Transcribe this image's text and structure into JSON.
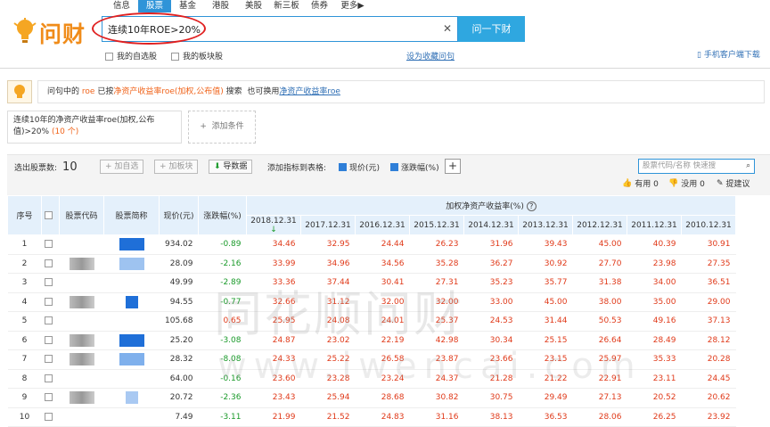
{
  "nav": {
    "tabs": [
      "信息",
      "股票",
      "基金",
      "港股",
      "美股",
      "新三板",
      "债券",
      "更多▶"
    ],
    "active": 1
  },
  "logo": {
    "text": "问财"
  },
  "search": {
    "value": "连续10年ROE>20%",
    "button": "问一下财"
  },
  "options": {
    "my_stocks": "我的自选股",
    "my_sectors": "我的板块股",
    "save_question": "设为收藏问句",
    "mobile": "手机客户端下载"
  },
  "notice": {
    "p1": "问句中的",
    "roe": "roe",
    "p2": "已按",
    "roe_full": "净资产收益率roe(加权,公布值)",
    "p3": "搜索",
    "p4": "也可换用",
    "alt": "净资产收益率roe"
  },
  "condition": {
    "text": "连续10年的净资产收益率roe(加权,公布值)>20%",
    "count": "(10 个)",
    "add": "添加条件"
  },
  "toolbar": {
    "count_label": "选出股票数:",
    "count": "10",
    "add_fav": "加自选",
    "add_sector": "加板块",
    "export": "导数据",
    "indicator_label": "添加指标到表格:",
    "ind_price": "现价(元)",
    "ind_change": "涨跌幅(%)",
    "plus": "+",
    "search_placeholder": "股票代码/名称 快速搜",
    "useful": "有用 0",
    "useless": "没用 0",
    "suggest": "提建议"
  },
  "table": {
    "headers": {
      "seq": "序号",
      "code": "股票代码",
      "name": "股票简称",
      "price": "现价(元)",
      "change": "涨跌幅(%)",
      "roe_group": "加权净资产收益率(%)"
    },
    "years": [
      "2018.12.31",
      "2017.12.31",
      "2016.12.31",
      "2015.12.31",
      "2014.12.31",
      "2013.12.31",
      "2012.12.31",
      "2011.12.31",
      "2010.12.31"
    ],
    "rows": [
      {
        "seq": "1",
        "price": "934.02",
        "change": "-0.89",
        "roe": [
          "34.46",
          "32.95",
          "24.44",
          "26.23",
          "31.96",
          "39.43",
          "45.00",
          "40.39",
          "30.91"
        ]
      },
      {
        "seq": "2",
        "price": "28.09",
        "change": "-2.16",
        "roe": [
          "33.99",
          "34.96",
          "34.56",
          "35.28",
          "36.27",
          "30.92",
          "27.70",
          "23.98",
          "27.35"
        ]
      },
      {
        "seq": "3",
        "price": "49.99",
        "change": "-2.89",
        "roe": [
          "33.36",
          "37.44",
          "30.41",
          "27.31",
          "35.23",
          "35.77",
          "31.38",
          "34.00",
          "36.51"
        ]
      },
      {
        "seq": "4",
        "price": "94.55",
        "change": "-0.77",
        "roe": [
          "32.66",
          "31.12",
          "32.00",
          "32.00",
          "33.00",
          "45.00",
          "38.00",
          "35.00",
          "29.00"
        ]
      },
      {
        "seq": "5",
        "price": "105.68",
        "change": "0.65",
        "roe": [
          "25.95",
          "24.08",
          "24.01",
          "25.37",
          "24.53",
          "31.44",
          "50.53",
          "49.16",
          "37.13"
        ]
      },
      {
        "seq": "6",
        "price": "25.20",
        "change": "-3.08",
        "roe": [
          "24.87",
          "23.02",
          "22.19",
          "42.98",
          "30.34",
          "25.15",
          "26.64",
          "28.49",
          "28.12"
        ]
      },
      {
        "seq": "7",
        "price": "28.32",
        "change": "-8.08",
        "roe": [
          "24.33",
          "25.22",
          "26.58",
          "23.87",
          "23.66",
          "23.15",
          "25.97",
          "35.33",
          "20.28"
        ]
      },
      {
        "seq": "8",
        "price": "64.00",
        "change": "-0.16",
        "roe": [
          "23.60",
          "23.28",
          "23.24",
          "24.37",
          "21.28",
          "21.22",
          "22.91",
          "23.11",
          "24.45"
        ]
      },
      {
        "seq": "9",
        "price": "20.72",
        "change": "-2.36",
        "roe": [
          "23.43",
          "25.94",
          "28.68",
          "30.82",
          "30.75",
          "29.49",
          "27.13",
          "20.52",
          "20.62"
        ]
      },
      {
        "seq": "10",
        "price": "7.49",
        "change": "-3.11",
        "roe": [
          "21.99",
          "21.52",
          "24.83",
          "31.16",
          "38.13",
          "36.53",
          "28.06",
          "26.25",
          "23.92"
        ]
      }
    ]
  },
  "watermark": {
    "cn": "同花顺问财",
    "en": "www.iwencai.com"
  },
  "colors": {
    "accent": "#2f94d8",
    "up": "#e03a1a",
    "down": "#1a9a2a",
    "logo": "#f08c1a"
  }
}
